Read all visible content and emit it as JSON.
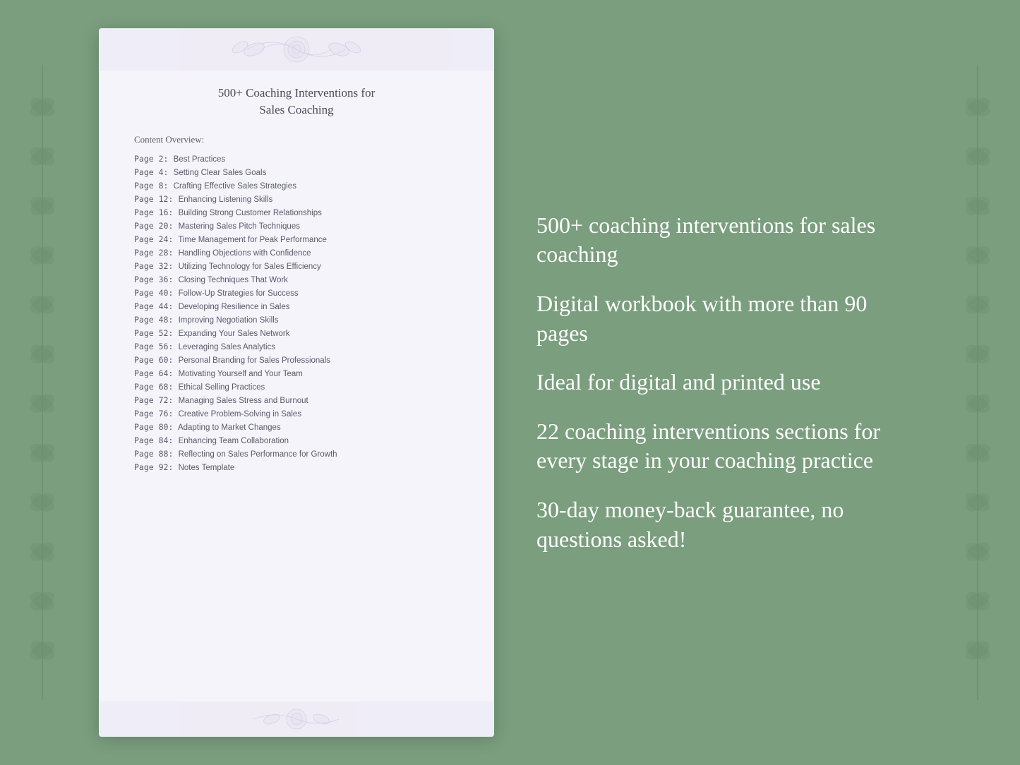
{
  "document": {
    "title_line1": "500+ Coaching Interventions for",
    "title_line2": "Sales Coaching",
    "content_overview_label": "Content Overview:",
    "toc_items": [
      {
        "page": "Page  2:",
        "title": "Best Practices"
      },
      {
        "page": "Page  4:",
        "title": "Setting Clear Sales Goals"
      },
      {
        "page": "Page  8:",
        "title": "Crafting Effective Sales Strategies"
      },
      {
        "page": "Page 12:",
        "title": "Enhancing Listening Skills"
      },
      {
        "page": "Page 16:",
        "title": "Building Strong Customer Relationships"
      },
      {
        "page": "Page 20:",
        "title": "Mastering Sales Pitch Techniques"
      },
      {
        "page": "Page 24:",
        "title": "Time Management for Peak Performance"
      },
      {
        "page": "Page 28:",
        "title": "Handling Objections with Confidence"
      },
      {
        "page": "Page 32:",
        "title": "Utilizing Technology for Sales Efficiency"
      },
      {
        "page": "Page 36:",
        "title": "Closing Techniques That Work"
      },
      {
        "page": "Page 40:",
        "title": "Follow-Up Strategies for Success"
      },
      {
        "page": "Page 44:",
        "title": "Developing Resilience in Sales"
      },
      {
        "page": "Page 48:",
        "title": "Improving Negotiation Skills"
      },
      {
        "page": "Page 52:",
        "title": "Expanding Your Sales Network"
      },
      {
        "page": "Page 56:",
        "title": "Leveraging Sales Analytics"
      },
      {
        "page": "Page 60:",
        "title": "Personal Branding for Sales Professionals"
      },
      {
        "page": "Page 64:",
        "title": "Motivating Yourself and Your Team"
      },
      {
        "page": "Page 68:",
        "title": "Ethical Selling Practices"
      },
      {
        "page": "Page 72:",
        "title": "Managing Sales Stress and Burnout"
      },
      {
        "page": "Page 76:",
        "title": "Creative Problem-Solving in Sales"
      },
      {
        "page": "Page 80:",
        "title": "Adapting to Market Changes"
      },
      {
        "page": "Page 84:",
        "title": "Enhancing Team Collaboration"
      },
      {
        "page": "Page 88:",
        "title": "Reflecting on Sales Performance for Growth"
      },
      {
        "page": "Page 92:",
        "title": "Notes Template"
      }
    ]
  },
  "features": [
    {
      "id": "f1",
      "text": "500+ coaching interventions for sales coaching"
    },
    {
      "id": "f2",
      "text": "Digital workbook with more than 90 pages"
    },
    {
      "id": "f3",
      "text": "Ideal for digital and printed use"
    },
    {
      "id": "f4",
      "text": "22 coaching interventions sections for every stage in your coaching practice"
    },
    {
      "id": "f5",
      "text": "30-day money-back guarantee, no questions asked!"
    }
  ]
}
